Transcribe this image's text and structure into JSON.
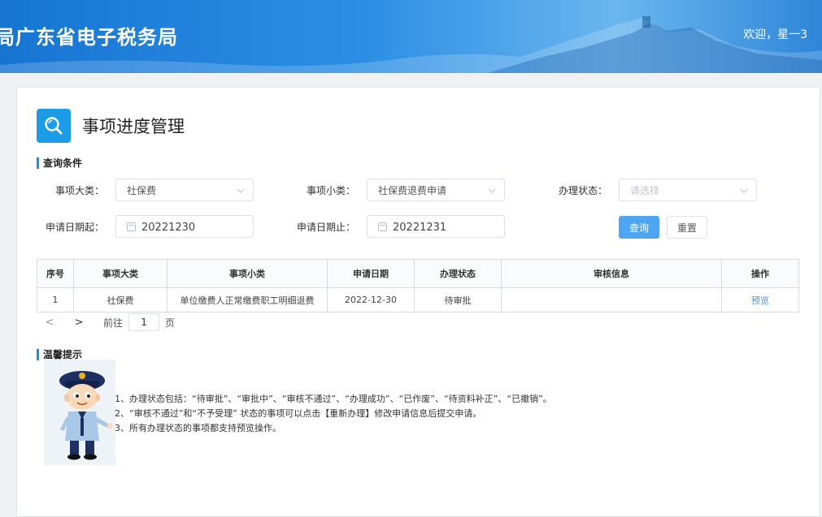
{
  "header": {
    "title": "局广东省电子税务局",
    "welcome": "欢迎，星一3"
  },
  "page": {
    "title": "事项进度管理",
    "icon": "search-icon"
  },
  "query": {
    "section_title": "查询条件",
    "fields": {
      "category": {
        "label": "事项大类：",
        "value": "社保费"
      },
      "subcategory": {
        "label": "事项小类：",
        "value": "社保费退费申请"
      },
      "status": {
        "label": "办理状态：",
        "placeholder": "请选择"
      },
      "start_date": {
        "label": "申请日期起：",
        "value": "20221230"
      },
      "end_date": {
        "label": "申请日期止：",
        "value": "20221231"
      }
    },
    "buttons": {
      "search": "查询",
      "reset": "重置"
    }
  },
  "table": {
    "columns": [
      "序号",
      "事项大类",
      "事项小类",
      "申请日期",
      "办理状态",
      "审核信息",
      "操作"
    ],
    "rows": [
      {
        "index": "1",
        "category": "社保费",
        "subcategory": "单位缴费人正常缴费职工明细退费",
        "date": "2022-12-30",
        "status": "待审批",
        "review": "",
        "action": "预览"
      }
    ]
  },
  "pager": {
    "prev": "<",
    "next": ">",
    "goto_prefix": "前往",
    "page": "1",
    "goto_suffix": "页"
  },
  "tips": {
    "section_title": "温馨提示",
    "lines": [
      "1、办理状态包括：“待审批”、“审批中”、“审核不通过”、“办理成功”、“已作废”、“待资料补正”、“已撤销”。",
      "2、“审核不通过”和“不予受理” 状态的事项可以点击【重新办理】修改申请信息后提交申请。",
      "3、所有办理状态的事项都支持预览操作。"
    ]
  },
  "colors": {
    "primary": "#1c9be6",
    "link": "#3b95e8",
    "banner": "#1775d2"
  }
}
